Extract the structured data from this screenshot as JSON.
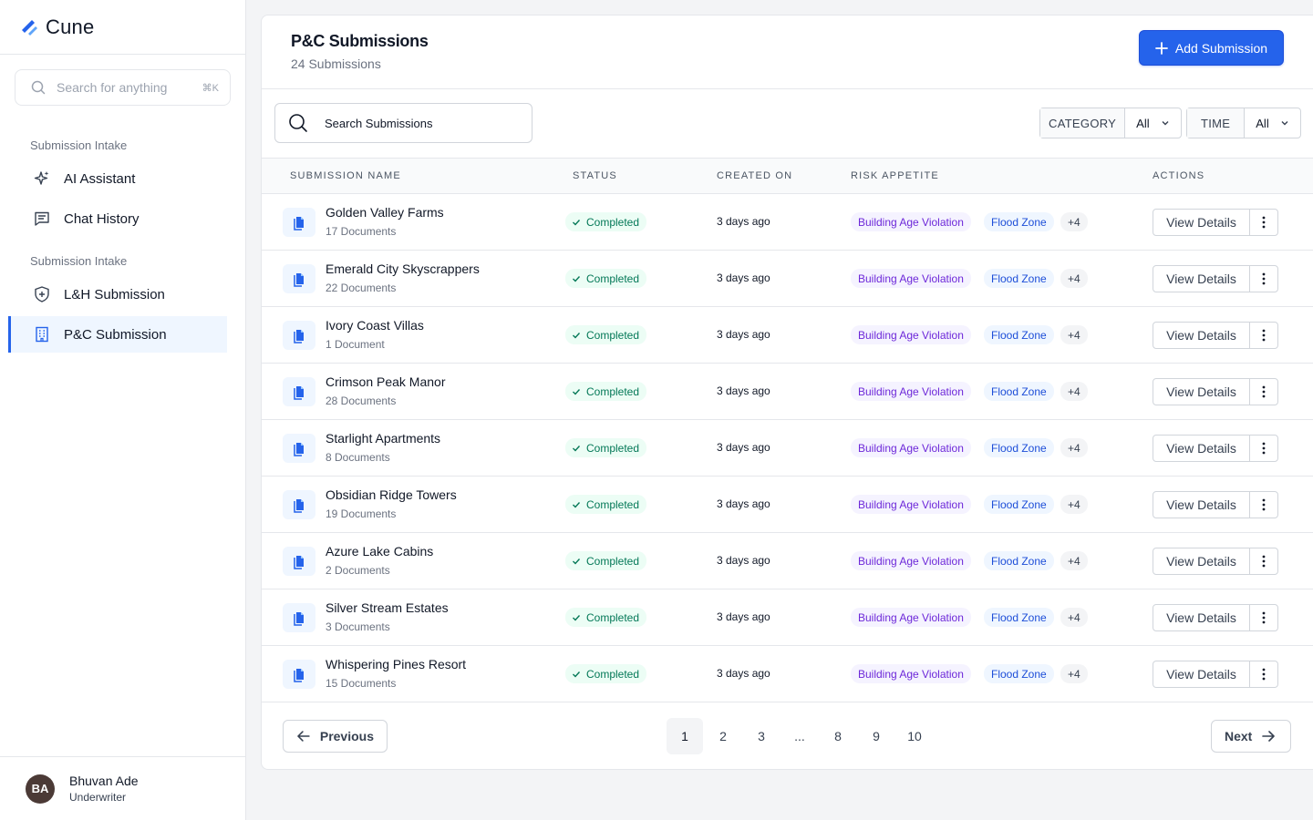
{
  "app": {
    "name": "Cune",
    "brand_color": "#2563eb"
  },
  "sidebar": {
    "search_placeholder": "Search for anything",
    "search_shortcut": "⌘K",
    "sections": [
      {
        "label": "Submission Intake",
        "items": [
          {
            "label": "AI Assistant",
            "icon": "sparkles-icon"
          },
          {
            "label": "Chat History",
            "icon": "chat-icon"
          }
        ]
      },
      {
        "label": "Submission Intake",
        "items": [
          {
            "label": "L&H Submission",
            "icon": "shield-icon"
          },
          {
            "label": "P&C Submission",
            "icon": "building-icon",
            "active": true
          }
        ]
      }
    ],
    "user": {
      "initials": "BA",
      "name": "Bhuvan Ade",
      "role": "Underwriter"
    }
  },
  "header": {
    "title": "P&C Submissions",
    "subtitle": "24 Submissions",
    "add_button": "Add Submission"
  },
  "toolbar": {
    "search_placeholder": "Search Submissions",
    "filters": [
      {
        "label": "CATEGORY",
        "value": "All"
      },
      {
        "label": "TIME",
        "value": "All"
      }
    ]
  },
  "table": {
    "columns": [
      "SUBMISSION NAME",
      "STATUS",
      "CREATED ON",
      "RISK APPETITE",
      "ACTIONS"
    ],
    "action_label": "View Details",
    "rows": [
      {
        "name": "Golden Valley Farms",
        "docs": "17 Documents",
        "status": "Completed",
        "created": "3 days ago",
        "tags": [
          "Building Age Violation",
          "Flood Zone",
          "+4"
        ]
      },
      {
        "name": "Emerald City Skyscrappers",
        "docs": "22 Documents",
        "status": "Completed",
        "created": "3 days ago",
        "tags": [
          "Building Age Violation",
          "Flood Zone",
          "+4"
        ]
      },
      {
        "name": "Ivory Coast Villas",
        "docs": "1 Document",
        "status": "Completed",
        "created": "3 days ago",
        "tags": [
          "Building Age Violation",
          "Flood Zone",
          "+4"
        ]
      },
      {
        "name": "Crimson Peak Manor",
        "docs": "28 Documents",
        "status": "Completed",
        "created": "3 days ago",
        "tags": [
          "Building Age Violation",
          "Flood Zone",
          "+4"
        ]
      },
      {
        "name": "Starlight Apartments",
        "docs": "8 Documents",
        "status": "Completed",
        "created": "3 days ago",
        "tags": [
          "Building Age Violation",
          "Flood Zone",
          "+4"
        ]
      },
      {
        "name": "Obsidian Ridge Towers",
        "docs": "19 Documents",
        "status": "Completed",
        "created": "3 days ago",
        "tags": [
          "Building Age Violation",
          "Flood Zone",
          "+4"
        ]
      },
      {
        "name": "Azure Lake Cabins",
        "docs": "2 Documents",
        "status": "Completed",
        "created": "3 days ago",
        "tags": [
          "Building Age Violation",
          "Flood Zone",
          "+4"
        ]
      },
      {
        "name": "Silver Stream Estates",
        "docs": "3 Documents",
        "status": "Completed",
        "created": "3 days ago",
        "tags": [
          "Building Age Violation",
          "Flood Zone",
          "+4"
        ]
      },
      {
        "name": "Whispering Pines Resort",
        "docs": "15 Documents",
        "status": "Completed",
        "created": "3 days ago",
        "tags": [
          "Building Age Violation",
          "Flood Zone",
          "+4"
        ]
      }
    ]
  },
  "pagination": {
    "previous": "Previous",
    "next": "Next",
    "pages": [
      "1",
      "2",
      "3",
      "...",
      "8",
      "9",
      "10"
    ],
    "current": "1"
  }
}
